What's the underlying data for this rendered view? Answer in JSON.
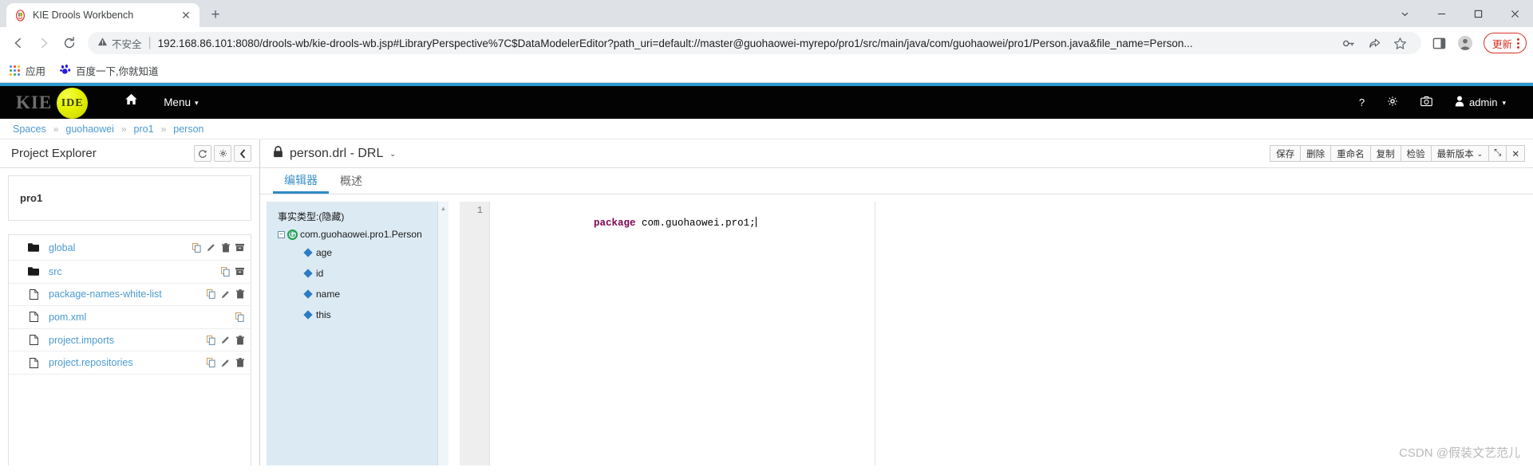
{
  "browser": {
    "tab": {
      "title": "KIE Drools Workbench",
      "favicon": "drools-favicon",
      "close_label": "✕"
    },
    "new_tab_label": "+",
    "window_controls": [
      "⌄",
      "─",
      "❐",
      "✕"
    ],
    "nav": {
      "back": "back-arrow",
      "forward": "forward-arrow",
      "reload": "reload-arrow"
    },
    "omnibox": {
      "security_label": "不安全",
      "security_icon": "warning-triangle",
      "separator": "|",
      "url": "192.168.86.101:8080/drools-wb/kie-drools-wb.jsp#LibraryPerspective%7C$DataModelerEditor?path_uri=default://master@guohaowei-myrepo/pro1/src/main/java/com/guohaowei/pro1/Person.java&file_name=Person...",
      "icons": [
        "key-icon",
        "share-icon",
        "star-icon"
      ]
    },
    "toolbar": {
      "side_panel": "side-panel-icon",
      "profile": "profile-avatar-icon",
      "update_label": "更新",
      "menu": "kebab-menu-icon"
    },
    "bookmarks": [
      {
        "label": "应用",
        "icon": "apps-grid-icon"
      },
      {
        "label": "百度一下,你就知道",
        "icon": "baidu-icon"
      }
    ]
  },
  "kie": {
    "logo": {
      "text": "KIE",
      "ball": "IDE"
    },
    "nav": [
      {
        "label": "",
        "icon": "home-icon"
      },
      {
        "label": "Menu",
        "icon": "chevron-down-icon"
      }
    ],
    "right": {
      "help": "?",
      "settings": "gear-icon",
      "camera": "camera-icon",
      "user": "admin",
      "user_icon": "user-icon",
      "caret": "⌄"
    },
    "breadcrumb": {
      "items": [
        "Spaces",
        "guohaowei",
        "pro1",
        "person"
      ],
      "separator": "»"
    },
    "explorer": {
      "title": "Project Explorer",
      "buttons": [
        {
          "name": "refresh-button",
          "glyph": "⟳"
        },
        {
          "name": "settings-button",
          "glyph": "⚙"
        },
        {
          "name": "collapse-button",
          "glyph": "‹"
        }
      ],
      "project_name": "pro1",
      "items": [
        {
          "label": "global",
          "type": "folder",
          "actions": [
            "copy-icon",
            "edit-icon",
            "delete-icon",
            "archive-icon"
          ]
        },
        {
          "label": "src",
          "type": "folder",
          "actions": [
            "copy-icon",
            "archive-icon"
          ]
        },
        {
          "label": "package-names-white-list",
          "type": "file",
          "actions": [
            "copy-icon",
            "edit-icon",
            "delete-icon"
          ]
        },
        {
          "label": "pom.xml",
          "type": "file",
          "actions": [
            "copy-icon"
          ]
        },
        {
          "label": "project.imports",
          "type": "file",
          "actions": [
            "copy-icon",
            "edit-icon",
            "delete-icon"
          ]
        },
        {
          "label": "project.repositories",
          "type": "file",
          "actions": [
            "copy-icon",
            "edit-icon",
            "delete-icon"
          ]
        }
      ]
    },
    "editor": {
      "lock_icon": "lock-icon",
      "filename": "person.drl - DRL",
      "filename_caret": "⌄",
      "buttons": [
        {
          "label": "保存",
          "name": "save-button"
        },
        {
          "label": "删除",
          "name": "delete-button"
        },
        {
          "label": "重命名",
          "name": "rename-button"
        },
        {
          "label": "复制",
          "name": "copy-button"
        },
        {
          "label": "检验",
          "name": "validate-button"
        },
        {
          "label": "最新版本",
          "name": "latest-version-button",
          "caret": "⌄"
        },
        {
          "label": "⤡",
          "name": "maximize-button"
        },
        {
          "label": "✕",
          "name": "close-button"
        }
      ],
      "tabs": [
        {
          "label": "编辑器",
          "active": true
        },
        {
          "label": "概述",
          "active": false
        }
      ],
      "fact_panel": {
        "title": "事实类型:(隐藏)",
        "root": "com.guohaowei.pro1.Person",
        "root_toggle": "−",
        "root_icon": "class-icon",
        "fields": [
          "age",
          "id",
          "name",
          "this"
        ]
      },
      "code": {
        "lines": [
          {
            "number": "1",
            "keyword": "package",
            "rest": " com.guohaowei.pro1;"
          }
        ]
      }
    }
  },
  "watermark": "CSDN @假装文艺范儿"
}
